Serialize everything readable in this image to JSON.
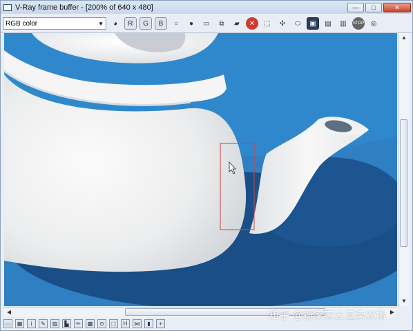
{
  "window": {
    "title": "V-Ray frame buffer - [200% of 640 x 480]",
    "minimize_label": "—",
    "maximize_label": "□",
    "close_label": "✕"
  },
  "toolbar": {
    "channel_value": "RGB color",
    "buttons": [
      {
        "icon": "color-wheel-icon",
        "glyph": "◕"
      },
      {
        "icon": "red-channel-icon",
        "glyph": "R"
      },
      {
        "icon": "green-channel-icon",
        "glyph": "G"
      },
      {
        "icon": "blue-channel-icon",
        "glyph": "B"
      },
      {
        "icon": "white-circle-icon",
        "glyph": "○"
      },
      {
        "icon": "gray-circle-icon",
        "glyph": "●"
      },
      {
        "icon": "save-icon",
        "glyph": "▭"
      },
      {
        "icon": "duplicate-icon",
        "glyph": "⧉"
      },
      {
        "icon": "open-folder-icon",
        "glyph": "▰"
      },
      {
        "icon": "clear-icon",
        "glyph": "✕"
      },
      {
        "icon": "region-render-icon",
        "glyph": "⬚"
      },
      {
        "icon": "track-mouse-icon",
        "glyph": "✣"
      },
      {
        "icon": "link-icon",
        "glyph": "⬭"
      },
      {
        "icon": "color-correction-icon",
        "glyph": "▣"
      },
      {
        "icon": "levels-icon",
        "glyph": "▤"
      },
      {
        "icon": "histogram-icon",
        "glyph": "▥"
      },
      {
        "icon": "stop-icon",
        "glyph": "STOP"
      },
      {
        "icon": "render-icon",
        "glyph": "◎"
      }
    ]
  },
  "status_buttons": [
    {
      "icon": "pixel-info-icon",
      "glyph": "▭"
    },
    {
      "icon": "table-icon",
      "glyph": "▦"
    },
    {
      "icon": "info-icon",
      "glyph": "i"
    },
    {
      "icon": "palette-icon",
      "glyph": "✎"
    },
    {
      "icon": "photo-icon",
      "glyph": "▨"
    },
    {
      "icon": "chart-icon",
      "glyph": "▙"
    },
    {
      "icon": "pencil-icon",
      "glyph": "✏"
    },
    {
      "icon": "grid-icon",
      "glyph": "▩"
    },
    {
      "icon": "lens-icon",
      "glyph": "⊙"
    },
    {
      "icon": "select-icon",
      "glyph": "⬚"
    },
    {
      "icon": "h-icon",
      "glyph": "H"
    },
    {
      "icon": "hv-icon",
      "glyph": "⋈"
    },
    {
      "icon": "bars-icon",
      "glyph": "▮"
    },
    {
      "icon": "plus-icon",
      "glyph": "+"
    }
  ],
  "watermark": "知乎 @扮家家云渲染农场",
  "colors": {
    "background_blue": "#2f7fc3",
    "shadow_blue": "#194f86",
    "teapot_white": "#f2f3f4",
    "region_red": "#d6403a"
  }
}
